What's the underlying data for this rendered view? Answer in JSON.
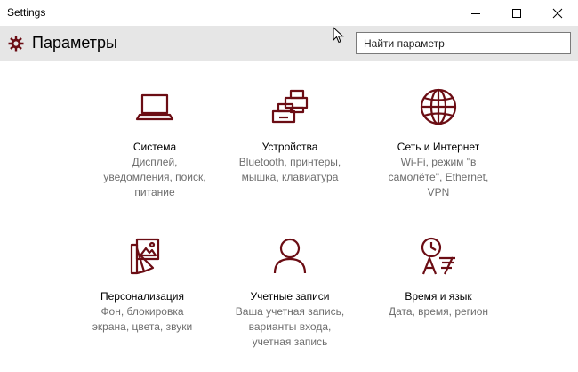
{
  "window": {
    "title": "Settings"
  },
  "header": {
    "title": "Параметры",
    "search_placeholder": "Найти параметр"
  },
  "colors": {
    "accent": "#6b0d14",
    "header_bg": "#e6e6e6",
    "description_text": "#6e6e6e"
  },
  "tiles": [
    {
      "icon": "laptop-icon",
      "name": "Система",
      "desc": [
        "Дисплей,",
        "уведомления, поиск,",
        "питание"
      ]
    },
    {
      "icon": "devices-icon",
      "name": "Устройства",
      "desc": [
        "Bluetooth, принтеры,",
        "мышка, клавиатура"
      ]
    },
    {
      "icon": "globe-icon",
      "name": "Сеть и Интернет",
      "desc": [
        "Wi-Fi, режим \"в",
        "самолёте\", Ethernet,",
        "VPN"
      ]
    },
    {
      "icon": "personalization-icon",
      "name": "Персонализация",
      "desc": [
        "Фон, блокировка",
        "экрана, цвета, звуки"
      ]
    },
    {
      "icon": "person-icon",
      "name": "Учетные записи",
      "desc": [
        "Ваша учетная запись,",
        "варианты входа,",
        "учетная запись"
      ]
    },
    {
      "icon": "time-language-icon",
      "name": "Время и язык",
      "desc": [
        "Дата, время, регион"
      ]
    }
  ]
}
